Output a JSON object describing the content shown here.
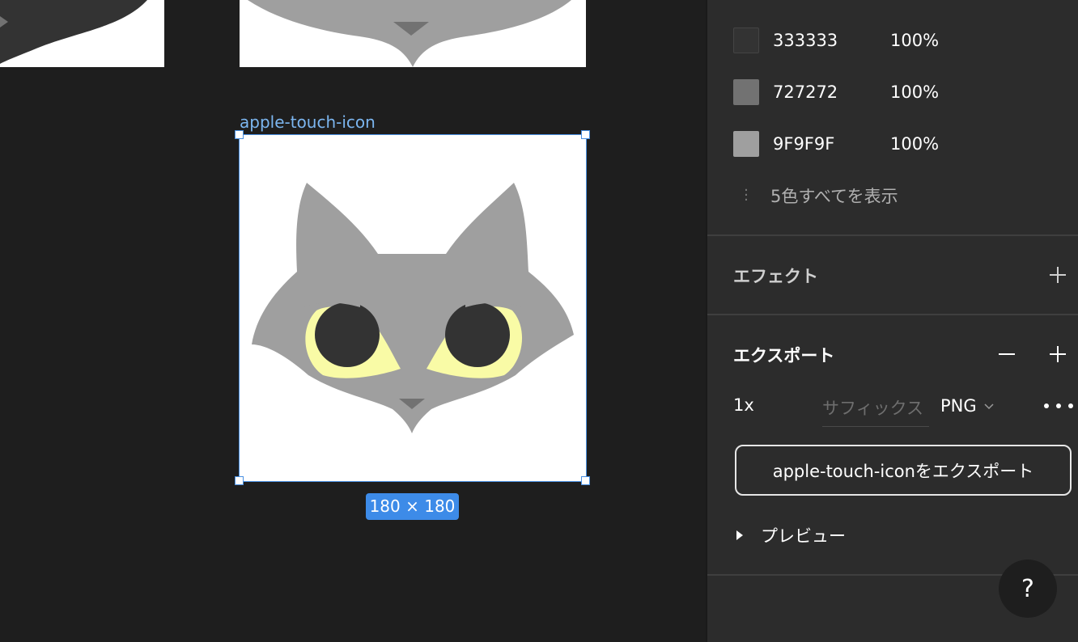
{
  "canvas": {
    "frame_label": "apple-touch-icon",
    "size_badge": "180 × 180"
  },
  "colors_section": {
    "items": [
      {
        "hex": "333333",
        "opacity": "100%",
        "color": "#333333"
      },
      {
        "hex": "727272",
        "opacity": "100%",
        "color": "#727272"
      },
      {
        "hex": "9F9F9F",
        "opacity": "100%",
        "color": "#9F9F9F"
      }
    ],
    "show_all_label": "5色すべてを表示"
  },
  "effects_section": {
    "title": "エフェクト"
  },
  "export_section": {
    "title": "エクスポート",
    "scale": "1x",
    "suffix_placeholder": "サフィックス",
    "format": "PNG",
    "export_button_label": "apple-touch-iconをエクスポート",
    "preview_label": "プレビュー"
  },
  "help": {
    "label": "?"
  },
  "icons": {
    "add": "plus-icon",
    "remove": "minus-icon",
    "more": "more-horizontal-icon",
    "format_dropdown": "chevron-down-icon",
    "preview_toggle": "triangle-right-icon",
    "help": "question-mark-icon"
  },
  "theme": {
    "canvas_bg": "#1e1e1e",
    "panel_bg": "#2c2c2c",
    "selection": "#4a90e2",
    "badge": "#3d8be8",
    "cat_gray": "#9F9F9F",
    "cat_nose": "#727272",
    "cat_pupil": "#333333",
    "cat_eye": "#f9fba6"
  }
}
